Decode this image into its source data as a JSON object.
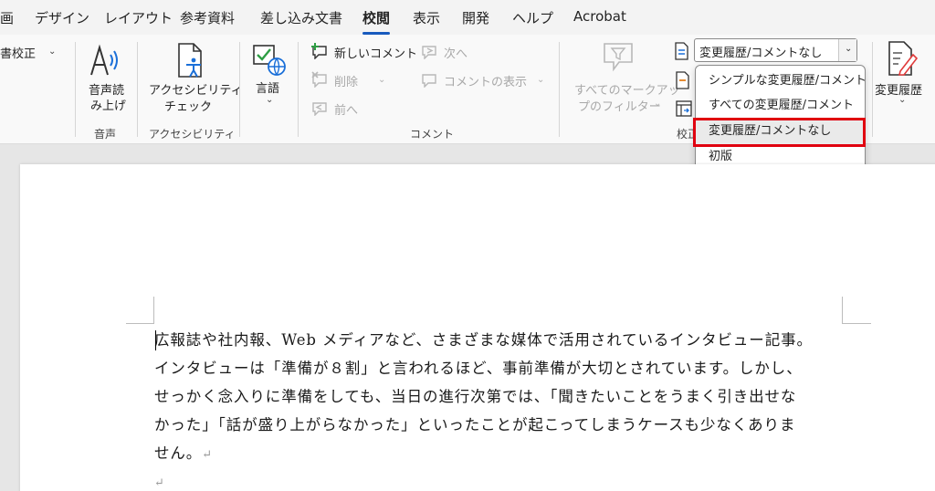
{
  "tabs": [
    "画",
    "デザイン",
    "レイアウト",
    "参考資料",
    "差し込み文書",
    "校閲",
    "表示",
    "開発",
    "ヘルプ",
    "Acrobat"
  ],
  "active_tab": "校閲",
  "ribbon": {
    "editor_partial": "書校正",
    "speech": {
      "line1": "音声読",
      "line2": "み上げ",
      "group": "音声"
    },
    "accessibility": {
      "line1": "アクセシビリティ",
      "line2": "チェック",
      "group": "アクセシビリティ"
    },
    "language": {
      "label": "言語"
    },
    "comments": {
      "new": "新しいコメント",
      "delete": "削除",
      "prev": "前へ",
      "next": "次へ",
      "show": "コメントの表示",
      "group": "コメント"
    },
    "markup_filter": {
      "line1": "すべてのマークアッ",
      "line2": "プのフィルター"
    },
    "tracking_group_partial": "校正",
    "track_changes": {
      "label": "変更履歴"
    }
  },
  "display_for_review": {
    "selected": "変更履歴/コメントなし",
    "options": [
      "シンプルな変更履歴/コメント",
      "すべての変更履歴/コメント",
      "変更履歴/コメントなし",
      "初版"
    ],
    "highlighted_index": 2
  },
  "document": {
    "lines": [
      "広報誌や社内報、Web メディアなど、さまざまな媒体で活用されているインタビュー記事。",
      "インタビューは「準備が８割」と言われるほど、事前準備が大切とされています。しかし、",
      "せっかく念入りに準備をしても、当日の進行次第では、「聞きたいことをうまく引き出せな",
      "かった」「話が盛り上がらなかった」といったことが起こってしまうケースも少なくありま",
      "せん。"
    ],
    "paragraph_mark": "↵"
  }
}
